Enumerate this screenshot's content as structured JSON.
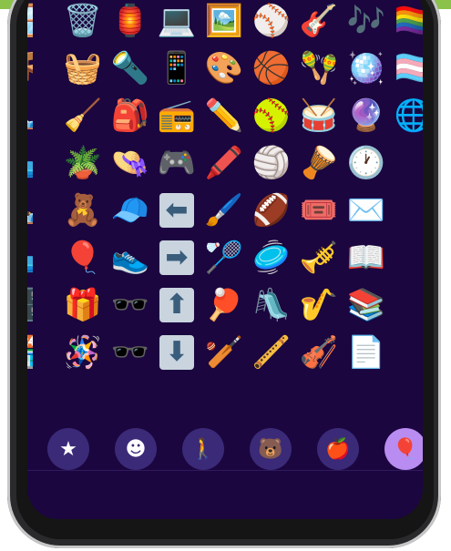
{
  "screen": {
    "grid_rows": [
      [
        "🪟",
        "🗑️",
        "🏮",
        "💻",
        "🖼️",
        "⚾",
        "🎸",
        "🎶",
        "🏳️‍🌈"
      ],
      [
        "🪑",
        "🧺",
        "🔦",
        "📱",
        "🎨",
        "🏀",
        "🪇",
        "🪩",
        "🏳️‍⚧️"
      ],
      [
        "🛏️",
        "🧹",
        "🎒",
        "📻",
        "✏️",
        "🥎",
        "🥁",
        "🔮",
        "🌐"
      ],
      [
        "🛋️",
        "🪴",
        "👒",
        "🎮",
        "🖍️",
        "🏐",
        "🪘",
        "🕐",
        ""
      ],
      [
        "🛌",
        "🧸",
        "🧢",
        "⬅",
        "🖌️",
        "🏈",
        "🎟️",
        "✉️",
        ""
      ],
      [
        "🛋️",
        "🎈",
        "👟",
        "➡",
        "🏸",
        "🥏",
        "🎺",
        "📖",
        ""
      ],
      [
        "🗄️",
        "🎁",
        "🕶️",
        "⬆",
        "🏓",
        "🛝",
        "🎷",
        "📚",
        ""
      ],
      [
        "🏪",
        "🪅",
        "🕶️",
        "⬇",
        "🏏",
        "🪈",
        "🎻",
        "📄",
        ""
      ]
    ],
    "categories": [
      {
        "name": "favorites",
        "icon": "star-icon",
        "glyph": "★"
      },
      {
        "name": "smileys",
        "icon": "smiley-icon",
        "glyph": "☻"
      },
      {
        "name": "people",
        "icon": "person-walking-icon",
        "glyph": "🚶"
      },
      {
        "name": "animals",
        "icon": "animal-face-icon",
        "glyph": "🐻"
      },
      {
        "name": "food",
        "icon": "apple-icon",
        "glyph": "🍎"
      },
      {
        "name": "objects",
        "icon": "balloon-icon",
        "glyph": "🎈"
      }
    ],
    "colors": {
      "background": "#1b063f",
      "category_bg": "#3a2a78",
      "category_active": "#b98cf1",
      "top_bar": "#8bc34a"
    }
  }
}
